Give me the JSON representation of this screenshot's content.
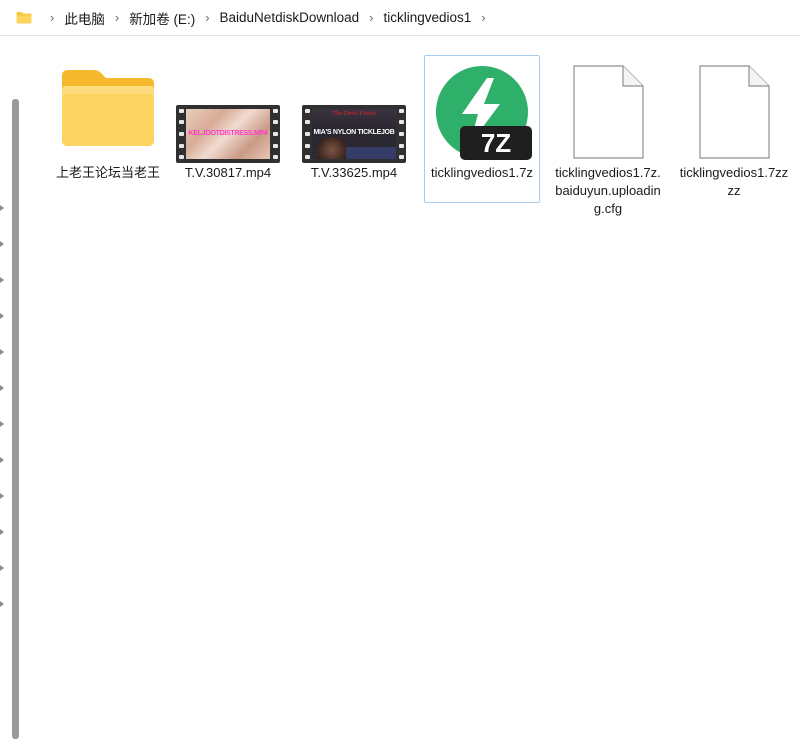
{
  "breadcrumb": {
    "items": [
      "此电脑",
      "新加卷 (E:)",
      "BaiduNetdiskDownload",
      "ticklingvedios1"
    ],
    "separator": "›"
  },
  "files": [
    {
      "name": "上老王论坛当老王",
      "type": "folder",
      "icon": "folder-icon",
      "selected": false
    },
    {
      "name": "T.V.30817.mp4",
      "type": "video",
      "icon": "video-thumbnail",
      "thumb_text": "KELJOOTDISTRESS.MP4",
      "selected": false
    },
    {
      "name": "T.V.33625.mp4",
      "type": "video",
      "icon": "video-thumbnail",
      "thumb_title": "The Devil Fetish",
      "thumb_text": "MIA'S NYLON TICKLEJOB",
      "selected": false
    },
    {
      "name": "ticklingvedios1.7z",
      "type": "archive",
      "icon": "7z-archive-icon",
      "icon_label": "7Z",
      "selected": true
    },
    {
      "name": "ticklingvedios1.7z.baiduyun.uploading.cfg",
      "type": "file",
      "icon": "blank-document-icon",
      "selected": false
    },
    {
      "name": "ticklingvedios1.7zzzz",
      "type": "file",
      "icon": "blank-document-icon",
      "selected": false
    }
  ],
  "colors": {
    "folder_yellow": "#f8c843",
    "archive_green": "#2fb06a",
    "selection_border": "#a6cbef"
  }
}
